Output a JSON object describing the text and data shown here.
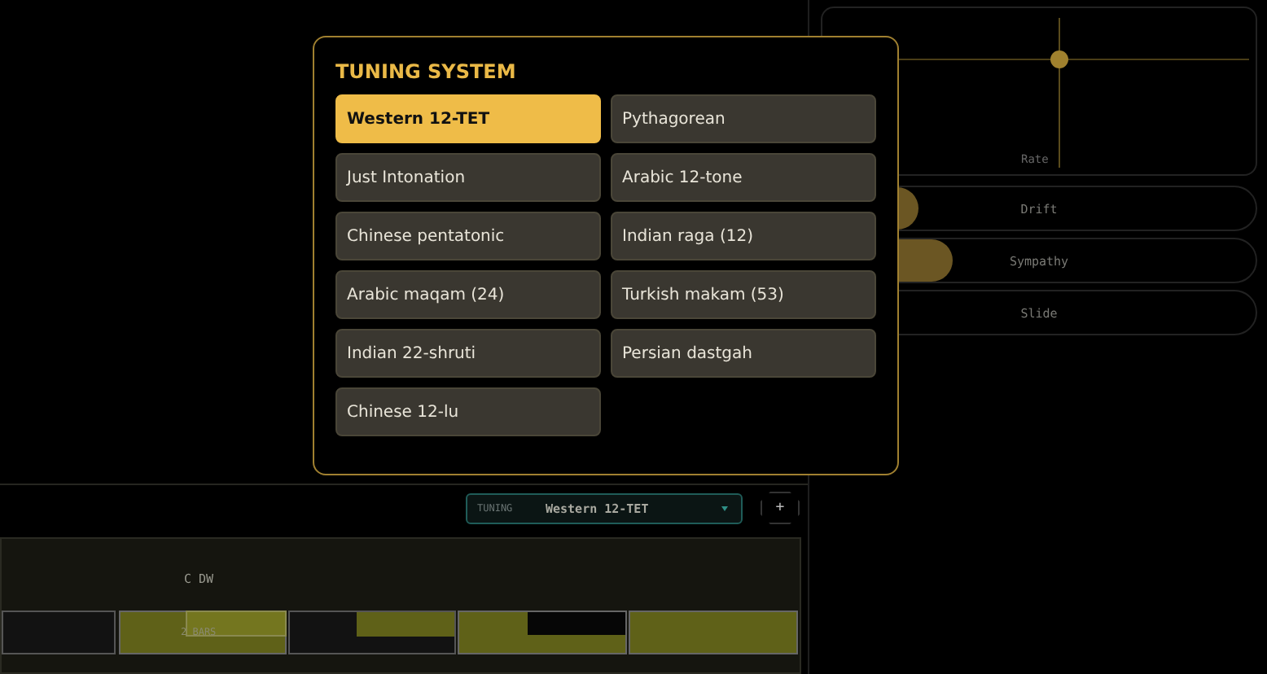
{
  "modal": {
    "title": "TUNING SYSTEM",
    "options": [
      {
        "label": "Western 12-TET",
        "selected": true
      },
      {
        "label": "Pythagorean",
        "selected": false
      },
      {
        "label": "Just Intonation",
        "selected": false
      },
      {
        "label": "Arabic 12-tone",
        "selected": false
      },
      {
        "label": "Chinese pentatonic",
        "selected": false
      },
      {
        "label": "Indian raga (12)",
        "selected": false
      },
      {
        "label": "Arabic maqam (24)",
        "selected": false
      },
      {
        "label": "Turkish makam (53)",
        "selected": false
      },
      {
        "label": "Indian 22-shruti",
        "selected": false
      },
      {
        "label": "Persian dastgah",
        "selected": false
      },
      {
        "label": "Chinese 12-lu",
        "selected": false
      }
    ]
  },
  "xy_pad": {
    "axis_label": "Rate"
  },
  "sliders": [
    {
      "label": "Drift",
      "level": 0.22
    },
    {
      "label": "Sympathy",
      "level": 0.3
    },
    {
      "label": "Slide",
      "level": 0
    }
  ],
  "toolbar": {
    "tuning_label": "TUNING",
    "tuning_value": "Western 12-TET",
    "add_button": "+"
  },
  "track": {
    "label": "C DW",
    "bars_label": "2 BARS"
  }
}
